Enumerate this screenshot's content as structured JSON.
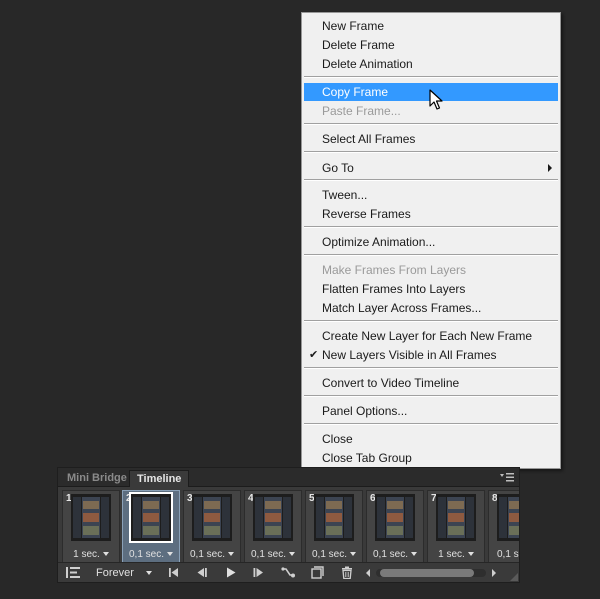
{
  "menu": {
    "items": [
      {
        "label": "New Frame",
        "state": "enabled"
      },
      {
        "label": "Delete Frame",
        "state": "enabled"
      },
      {
        "label": "Delete Animation",
        "state": "enabled"
      },
      {
        "label": "Copy Frame",
        "state": "highlighted"
      },
      {
        "label": "Paste Frame...",
        "state": "disabled"
      },
      {
        "label": "Select All Frames",
        "state": "enabled"
      },
      {
        "label": "Go To",
        "state": "enabled",
        "submenu": true
      },
      {
        "label": "Tween...",
        "state": "enabled"
      },
      {
        "label": "Reverse Frames",
        "state": "enabled"
      },
      {
        "label": "Optimize Animation...",
        "state": "enabled"
      },
      {
        "label": "Make Frames From Layers",
        "state": "disabled"
      },
      {
        "label": "Flatten Frames Into Layers",
        "state": "enabled"
      },
      {
        "label": "Match Layer Across Frames...",
        "state": "enabled"
      },
      {
        "label": "Create New Layer for Each New Frame",
        "state": "enabled"
      },
      {
        "label": "New Layers Visible in All Frames",
        "state": "enabled",
        "checked": true
      },
      {
        "label": "Convert to Video Timeline",
        "state": "enabled"
      },
      {
        "label": "Panel Options...",
        "state": "enabled"
      },
      {
        "label": "Close",
        "state": "enabled"
      },
      {
        "label": "Close Tab Group",
        "state": "enabled"
      }
    ],
    "check_mark": "✔"
  },
  "panel": {
    "tabs": [
      {
        "label": "Mini Bridge",
        "active": false
      },
      {
        "label": "Timeline",
        "active": true
      }
    ],
    "frames": [
      {
        "number": "1",
        "delay": "1 sec.",
        "selected": false
      },
      {
        "number": "2",
        "delay": "0,1 sec.",
        "selected": true
      },
      {
        "number": "3",
        "delay": "0,1 sec.",
        "selected": false
      },
      {
        "number": "4",
        "delay": "0,1 sec.",
        "selected": false
      },
      {
        "number": "5",
        "delay": "0,1 sec.",
        "selected": false
      },
      {
        "number": "6",
        "delay": "0,1 sec.",
        "selected": false
      },
      {
        "number": "7",
        "delay": "1 sec.",
        "selected": false
      },
      {
        "number": "8",
        "delay": "0,1 s",
        "selected": false
      }
    ],
    "loop_option": "Forever",
    "controls": [
      "convert-icon",
      "first-frame-icon",
      "previous-frame-icon",
      "play-icon",
      "next-frame-icon",
      "tween-icon",
      "duplicate-frame-icon",
      "delete-frame-icon"
    ]
  },
  "colors": {
    "highlight": "#3399ff",
    "selected_frame": "#5d6e80",
    "background": "#282828"
  }
}
